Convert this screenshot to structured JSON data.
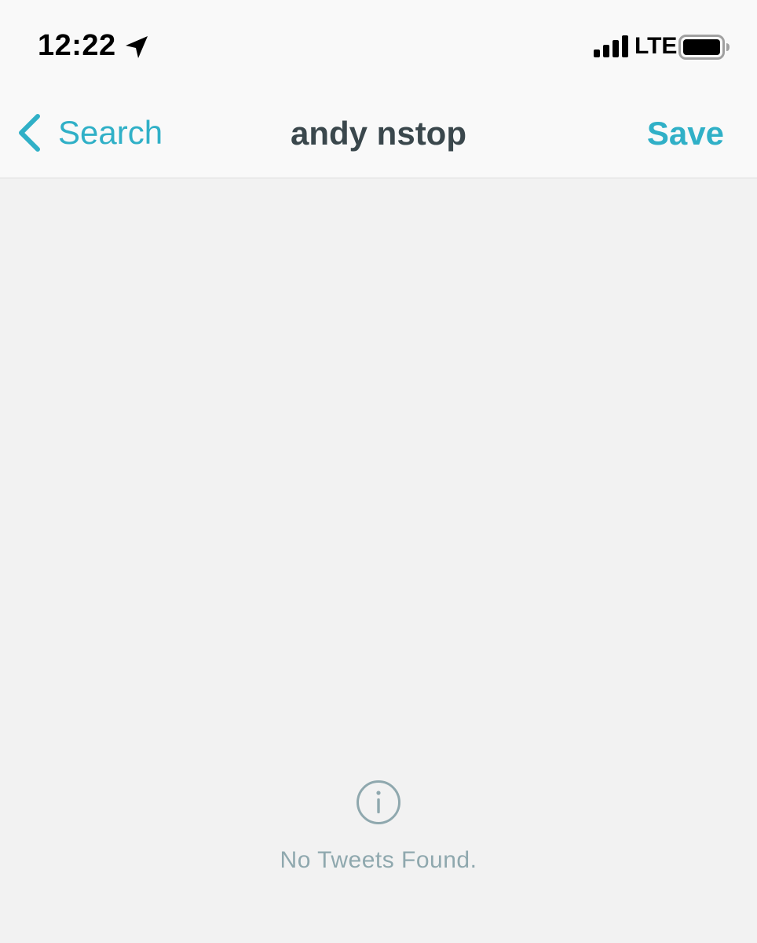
{
  "status_bar": {
    "time": "12:22",
    "network": "LTE",
    "icons": {
      "location": "location-arrow-icon",
      "signal": "cellular-signal-icon",
      "battery": "battery-icon"
    }
  },
  "nav": {
    "back_label": "Search",
    "title": "andy nstop",
    "save_label": "Save",
    "icons": {
      "back": "chevron-left-icon"
    }
  },
  "empty_state": {
    "icon": "info-icon",
    "message": "No Tweets Found."
  },
  "colors": {
    "accent": "#30b0c7",
    "title": "#3a474c",
    "muted": "#8fa8ae",
    "background": "#f2f2f2",
    "bar_background": "#f9f9f9"
  }
}
